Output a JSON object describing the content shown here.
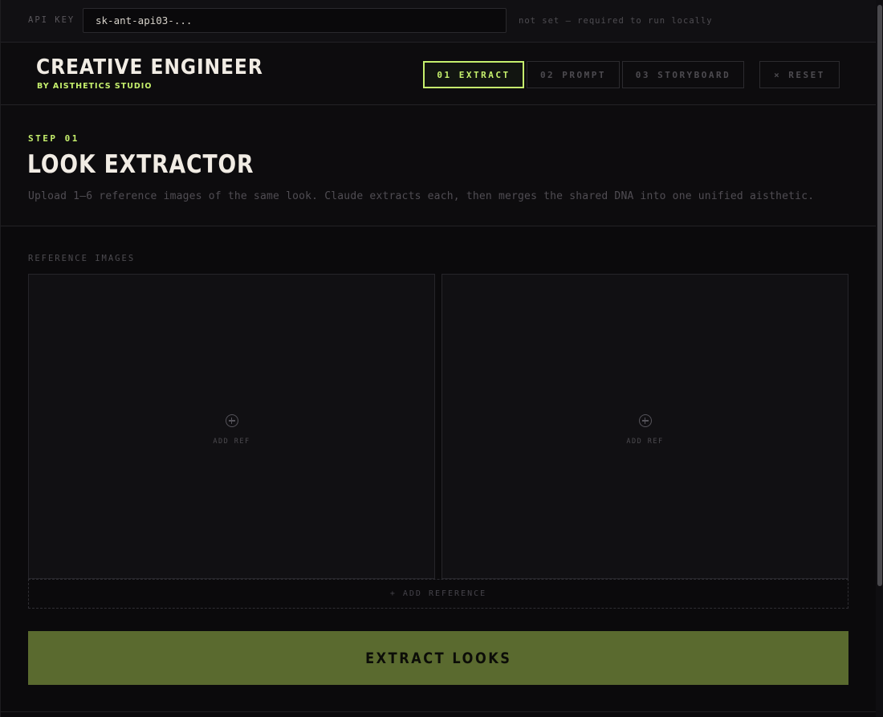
{
  "api": {
    "label": "API KEY",
    "value": "sk-ant-api03-...",
    "status": "not set — required to run locally"
  },
  "brand": {
    "title": "CREATIVE ENGINEER",
    "subtitle": "BY AISTHETICS STUDIO"
  },
  "tabs": [
    {
      "label": "01 EXTRACT",
      "active": true
    },
    {
      "label": "02 PROMPT",
      "active": false
    },
    {
      "label": "03 STORYBOARD",
      "active": false
    }
  ],
  "reset_label": "× RESET",
  "step": {
    "label": "STEP 01",
    "title": "LOOK EXTRACTOR",
    "description": "Upload 1–6 reference images of the same look. Claude extracts each, then merges the shared DNA into one unified aisthetic."
  },
  "references": {
    "label": "REFERENCE IMAGES",
    "slots": [
      {
        "icon": "plus-circle-icon",
        "label": "ADD REF"
      },
      {
        "icon": "plus-circle-icon",
        "label": "ADD REF"
      }
    ],
    "add_button": "+ ADD REFERENCE"
  },
  "extract_button": "EXTRACT LOOKS",
  "colors": {
    "accent": "#c6f06d",
    "primary_button": "#5a6a2f",
    "background": "#0b0a0c"
  }
}
